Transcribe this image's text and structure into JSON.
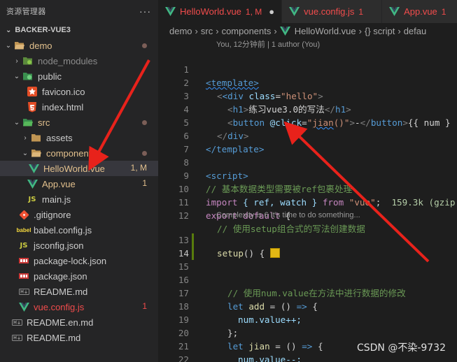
{
  "sidebar": {
    "title": "资源管理器",
    "more": "···",
    "section": "BACKER-VUE3",
    "items": [
      {
        "label": "demo",
        "badge": "",
        "state": "mod"
      },
      {
        "label": "node_modules",
        "badge": "",
        "state": "dim"
      },
      {
        "label": "public",
        "badge": "",
        "state": "normal"
      },
      {
        "label": "favicon.ico",
        "badge": "",
        "state": "normal"
      },
      {
        "label": "index.html",
        "badge": "",
        "state": "normal"
      },
      {
        "label": "src",
        "badge": "",
        "state": "mod"
      },
      {
        "label": "assets",
        "badge": "",
        "state": "normal"
      },
      {
        "label": "components",
        "badge": "",
        "state": "mod"
      },
      {
        "label": "HelloWorld.vue",
        "badge": "1, M",
        "state": "mod"
      },
      {
        "label": "App.vue",
        "badge": "1",
        "state": "mod"
      },
      {
        "label": "main.js",
        "badge": "",
        "state": "normal"
      },
      {
        "label": ".gitignore",
        "badge": "",
        "state": "normal"
      },
      {
        "label": "babel.config.js",
        "badge": "",
        "state": "normal"
      },
      {
        "label": "jsconfig.json",
        "badge": "",
        "state": "normal"
      },
      {
        "label": "package-lock.json",
        "badge": "",
        "state": "normal"
      },
      {
        "label": "package.json",
        "badge": "",
        "state": "normal"
      },
      {
        "label": "README.md",
        "badge": "",
        "state": "normal"
      },
      {
        "label": "vue.config.js",
        "badge": "1",
        "state": "err"
      },
      {
        "label": "README.en.md",
        "badge": "",
        "state": "normal"
      },
      {
        "label": "README.md",
        "badge": "",
        "state": "normal"
      }
    ]
  },
  "tabs": [
    {
      "label": "HelloWorld.vue",
      "badge": "1, M",
      "close": "●"
    },
    {
      "label": "vue.config.js",
      "badge": "1",
      "close": ""
    },
    {
      "label": "App.vue",
      "badge": "1",
      "close": ""
    }
  ],
  "breadcrumb": [
    "demo",
    "src",
    "components",
    "HelloWorld.vue",
    "{} script",
    "defau"
  ],
  "blame": "You, 12分钟前 | 1 author (You)",
  "codelens": "Complexity is 6 It's time to do something...",
  "code": {
    "l1": "<template>",
    "l2_open": "<div ",
    "l2_attr": "class",
    "l2_val": "\"hello\"",
    "l3_text": "练习vue3.0的写法",
    "l4_attr": "@click",
    "l4_val": "\"jian()\"",
    "l4_text": "-",
    "l4_tail": "{{ num }",
    "l6": "</template>",
    "l8": "<script>",
    "l9": "// 基本数据类型需要被ref包裹处理",
    "l10_a": "import",
    "l10_b": " { ref, watch } ",
    "l10_c": "from",
    "l10_d": "\"vue\"",
    "l10_size": "159.3k (gzip",
    "l11_a": "export",
    "l11_b": "default",
    "l12": "// 使用setup组合式的写法创建数据",
    "l13": "setup",
    "l16": "// 使用num.value在方法中进行数据的修改",
    "l17_kw": "let",
    "l17_var": "add",
    "l18": "num.value++;",
    "l19": "};",
    "l20_kw": "let",
    "l20_var": "jian",
    "l21": "num.value--;",
    "l22": "};"
  },
  "line_numbers": [
    "1",
    "2",
    "3",
    "4",
    "5",
    "6",
    "7",
    "8",
    "9",
    "10",
    "11",
    "12",
    "13",
    "14",
    "15",
    "16",
    "17",
    "18",
    "19",
    "20",
    "21",
    "22",
    "23"
  ],
  "watermark": "CSDN @不染-9732",
  "colors": {
    "accent_modified": "#e2c08d",
    "error": "#f14c4c",
    "vue_green": "#41b883"
  }
}
